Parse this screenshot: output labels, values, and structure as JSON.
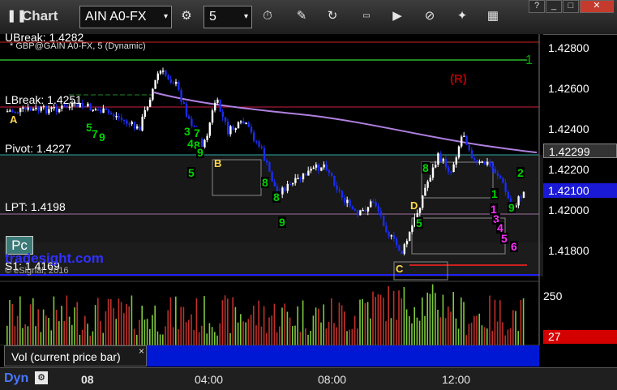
{
  "toolbar": {
    "title": "Chart",
    "symbol": "AIN A0-FX",
    "interval": "5",
    "icons": [
      "pause-icon",
      "gear-icon",
      "clock-icon",
      "pencil-icon",
      "refresh-icon",
      "order-icon",
      "play-icon",
      "cancel-icon",
      "link-icon",
      "grid-icon"
    ]
  },
  "window": {
    "help": "?",
    "minimize": "_",
    "maximize": "□",
    "close": "✕"
  },
  "chart": {
    "study_title": "* GBP@GAIN A0-FX, 5 (Dynamic)",
    "price_axis": [
      "1.42800",
      "1.42600",
      "1.42400",
      "1.42200",
      "1.42000",
      "1.41800"
    ],
    "levels": {
      "ubreak": "UBreak: 1.4282",
      "lbreak": "LBreak: 1.4251",
      "pivot": "Pivot: 1.4227",
      "lpt": "LPT: 1.4198",
      "s1": "S1: 1.4169"
    },
    "markers": {
      "a": "A",
      "b": "B",
      "c": "C",
      "d": "D"
    },
    "seq_green": [
      "3",
      "7",
      "4",
      "8",
      "9",
      "5",
      "5",
      "7",
      "8",
      "9",
      "8",
      "9",
      "5",
      "8",
      "9",
      "1",
      "2"
    ],
    "seq_magenta": [
      "1",
      "3",
      "4",
      "5",
      "6"
    ],
    "signal": "(R)",
    "count_mark": "1",
    "pc_button": "Pc",
    "watermark": "tradesight.com",
    "copyright": "© eSignal, 2016",
    "last_price": "1.42100",
    "prev_price": "1.42299"
  },
  "volume": {
    "axis_label": "250",
    "current_value": "27",
    "legend": "Vol (current price bar)",
    "legend_close": "×"
  },
  "xaxis": {
    "dyn_label": "Dyn",
    "ticks": [
      "08",
      "04:00",
      "08:00",
      "12:00"
    ]
  },
  "colors": {
    "up_bar": "#ffffff",
    "down_bar": "#1a2cf0",
    "ubreak_line": "#cc2020",
    "lbreak_line": "#cc2040",
    "pivot_line": "#30a8a8",
    "lpt_line": "#b080b0",
    "s1_line": "#2020ff",
    "ma_line": "#b080e0",
    "vol_up": "#7ec93c",
    "vol_down": "#c0302a"
  }
}
